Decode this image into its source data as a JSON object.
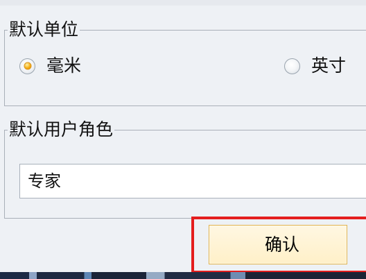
{
  "window": {
    "partial_title": ""
  },
  "settings": {
    "unit_group": {
      "title": "默认单位",
      "options": [
        {
          "label": "毫米",
          "checked": true
        },
        {
          "label": "英寸",
          "checked": false
        }
      ]
    },
    "role_group": {
      "title": "默认用户角色",
      "value": "专家"
    }
  },
  "actions": {
    "confirm": "确认"
  },
  "colors": {
    "highlight": "#e41e1e",
    "radio_selected": "#f3a300",
    "button_border": "#e1b44f"
  }
}
